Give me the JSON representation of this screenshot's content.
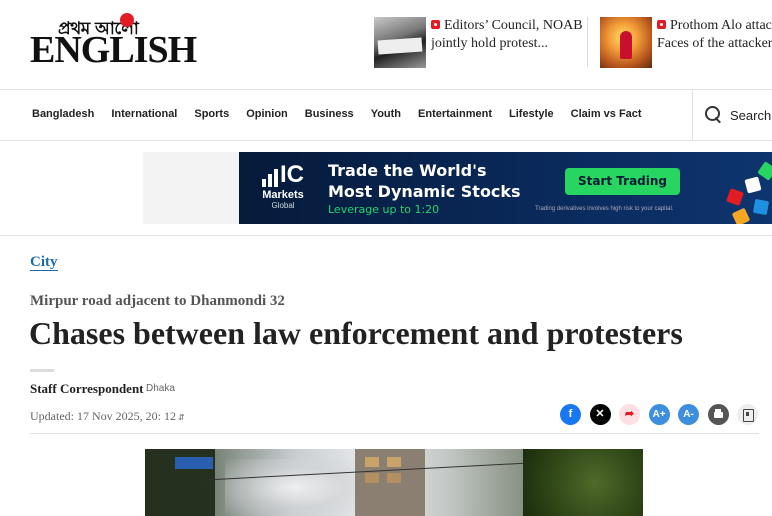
{
  "header": {
    "logo_bengali": "প্রথম আলো",
    "logo_english": "ENGLISH",
    "top_stories": [
      {
        "text_line1": "Editors’ Council, NOAB",
        "text_line2": "jointly hold protest..."
      },
      {
        "text_line1": "Prothom Alo attac",
        "text_line2": "Faces of the attackers"
      }
    ]
  },
  "nav": {
    "items": [
      "Bangladesh",
      "International",
      "Sports",
      "Opinion",
      "Business",
      "Youth",
      "Entertainment",
      "Lifestyle",
      "Claim vs Fact"
    ],
    "search_label": "Search"
  },
  "ad": {
    "brand_mark": "IC",
    "brand_name": "Markets",
    "brand_sub": "Global",
    "headline_1": "Trade the World's",
    "headline_2": "Most Dynamic Stocks",
    "leverage": "Leverage up to 1:20",
    "cta": "Start Trading",
    "risk": "Trading derivatives involves high risk to your capital."
  },
  "article": {
    "section": "City",
    "kicker": "Mirpur road adjacent to Dhanmondi 32",
    "headline": "Chases between law enforcement and protesters",
    "author": "Staff Correspondent",
    "place": "Dhaka",
    "updated": "Updated: 17 Nov 2025, 20: 12",
    "share_icons": [
      "facebook-icon",
      "x-icon",
      "share-icon",
      "font-increase-icon",
      "font-decrease-icon",
      "print-icon",
      "bookmark-icon"
    ],
    "font_plus": "A+",
    "font_minus": "A-"
  },
  "colors": {
    "link": "#1a6bb0",
    "brand_red": "#e31b23",
    "facebook": "#1877f2",
    "ad_cta": "#27d561"
  }
}
